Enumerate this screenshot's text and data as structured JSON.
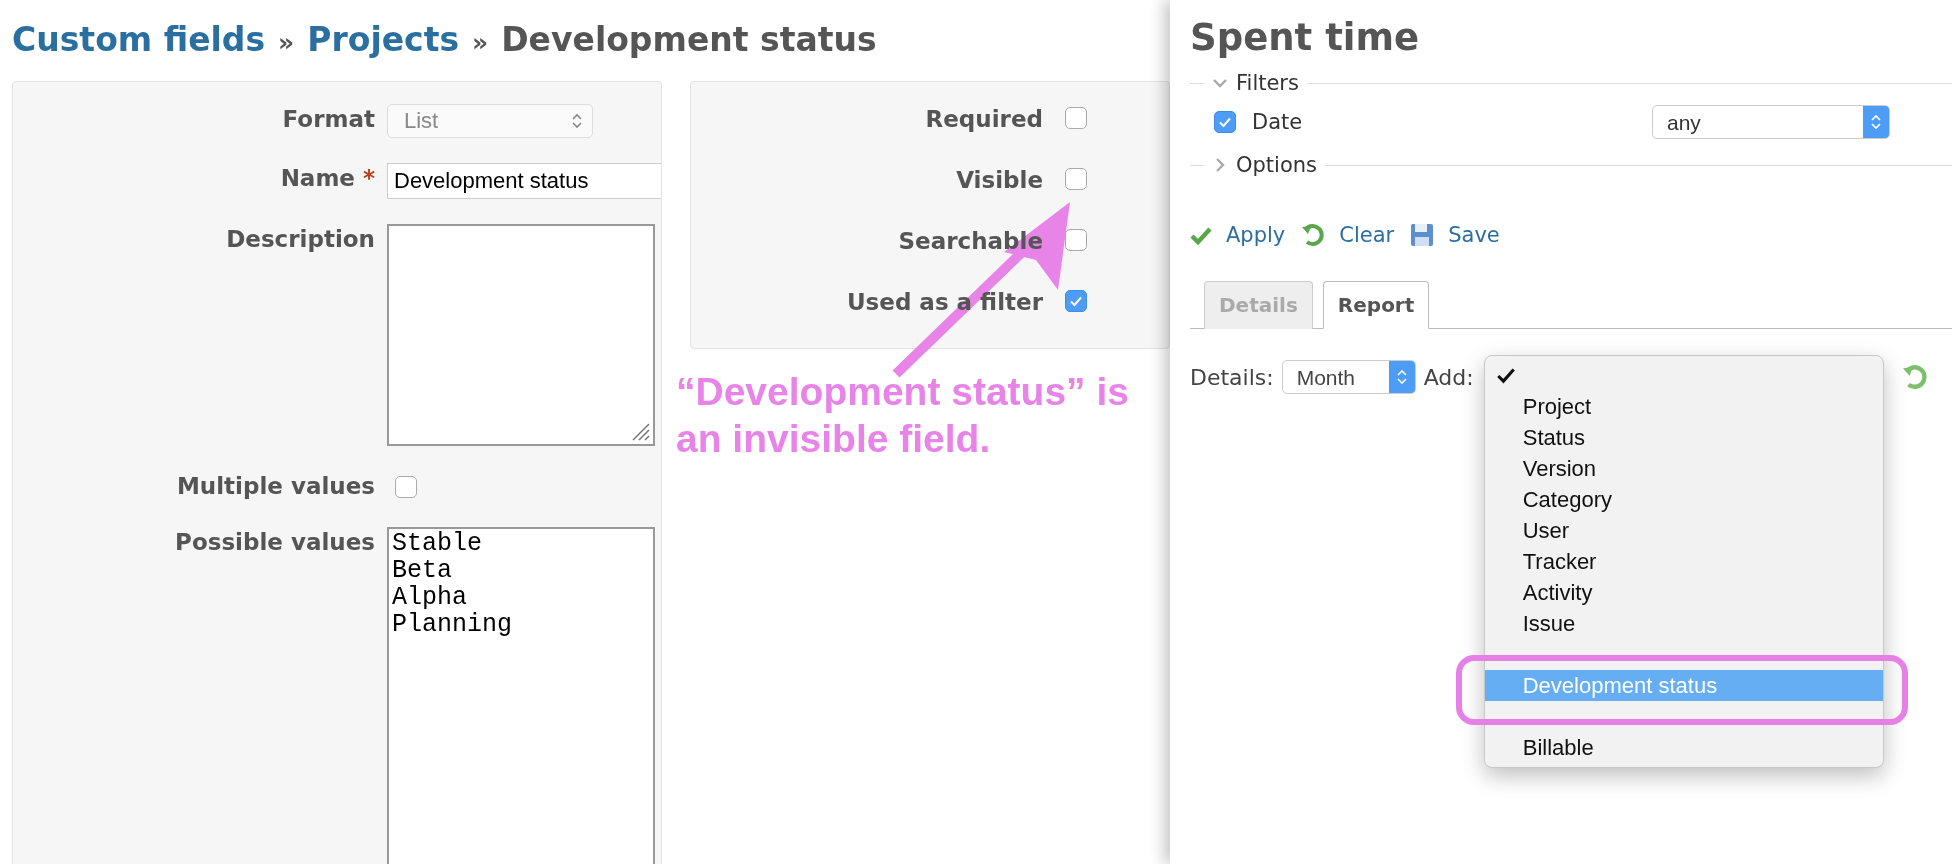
{
  "breadcrumb": [
    {
      "text": "Custom fields",
      "kind": "link"
    },
    {
      "text": "»",
      "kind": "separator"
    },
    {
      "text": "Projects",
      "kind": "link"
    },
    {
      "text": "»",
      "kind": "separator"
    },
    {
      "text": "Development status",
      "kind": "current"
    }
  ],
  "field_form": [
    {
      "kind": "select",
      "label": "Format",
      "value": "List",
      "disabled": true
    },
    {
      "kind": "text",
      "label": "Name",
      "required_mark": "*",
      "value": "Development status"
    },
    {
      "kind": "textarea",
      "label": "Description"
    },
    {
      "kind": "checkbox",
      "label": "Multiple values",
      "checked": false
    },
    {
      "kind": "textarea",
      "label": "Possible values",
      "lines": [
        "Stable",
        "Beta",
        "Alpha",
        "Planning"
      ]
    }
  ],
  "flags": [
    {
      "label": "Required",
      "checked": false
    },
    {
      "label": "Visible",
      "checked": false
    },
    {
      "label": "Searchable",
      "checked": false
    },
    {
      "label": "Used as a filter",
      "checked": true
    }
  ],
  "annotation": {
    "lines": [
      "“Development status” is",
      "an invisible field."
    ]
  },
  "spent_time": {
    "title": "Spent time",
    "filters": {
      "legend": "Filters",
      "expanded": true,
      "rows": [
        {
          "label": "Date",
          "checked": true,
          "operator": "any"
        }
      ]
    },
    "options": {
      "legend": "Options",
      "expanded": false
    },
    "actions": [
      {
        "label": "Apply",
        "kind": "apply"
      },
      {
        "label": "Clear",
        "kind": "clear"
      },
      {
        "label": "Save",
        "kind": "save"
      }
    ],
    "tabs": [
      {
        "label": "Details",
        "selected": false
      },
      {
        "label": "Report",
        "selected": true
      }
    ],
    "report": {
      "details_label": "Details:",
      "details_value": "Month",
      "add_label": "Add:",
      "add_options": [
        {
          "kind": "blank",
          "checked": true,
          "highlighted": false
        },
        {
          "kind": "option",
          "label": "Project",
          "checked": false,
          "highlighted": false
        },
        {
          "kind": "option",
          "label": "Status",
          "checked": false,
          "highlighted": false
        },
        {
          "kind": "option",
          "label": "Version",
          "checked": false,
          "highlighted": false
        },
        {
          "kind": "option",
          "label": "Category",
          "checked": false,
          "highlighted": false
        },
        {
          "kind": "option",
          "label": "User",
          "checked": false,
          "highlighted": false
        },
        {
          "kind": "option",
          "label": "Tracker",
          "checked": false,
          "highlighted": false
        },
        {
          "kind": "option",
          "label": "Activity",
          "checked": false,
          "highlighted": false
        },
        {
          "kind": "option",
          "label": "Issue",
          "checked": false,
          "highlighted": false
        },
        {
          "kind": "covered"
        },
        {
          "kind": "option",
          "label": "Development status",
          "checked": false,
          "highlighted": true
        },
        {
          "kind": "covered"
        },
        {
          "kind": "option",
          "label": "Billable",
          "checked": false,
          "highlighted": false
        }
      ]
    }
  }
}
